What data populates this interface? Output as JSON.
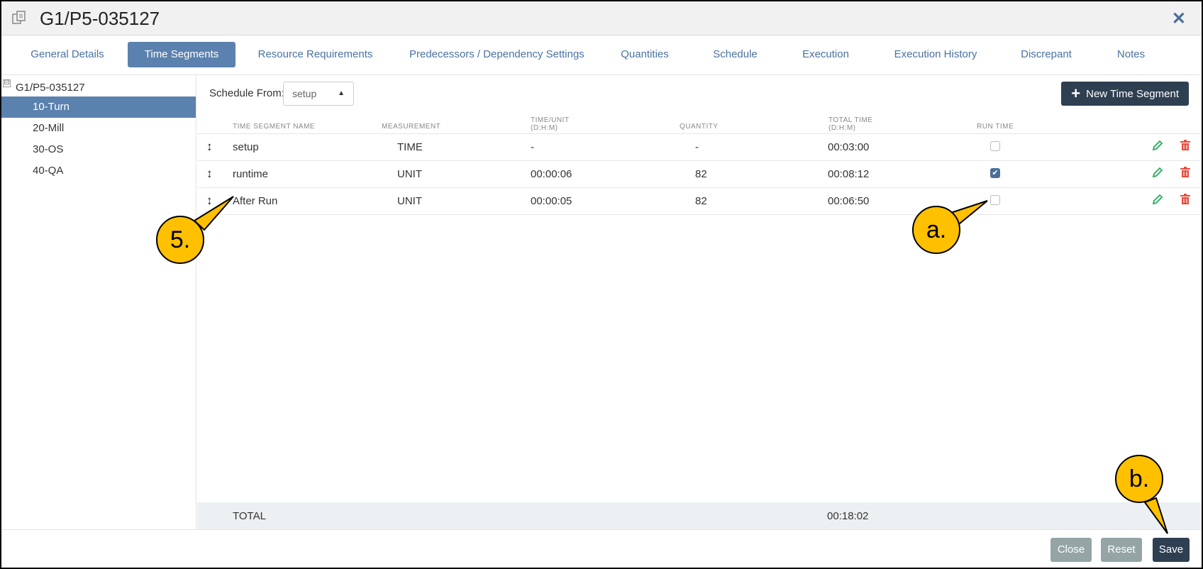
{
  "window": {
    "title": "G1/P5-035127",
    "icon": "copy-icon",
    "close_icon": "close-icon"
  },
  "tabs": [
    {
      "label": "General Details",
      "active": false
    },
    {
      "label": "Time Segments",
      "active": true
    },
    {
      "label": "Resource Requirements",
      "active": false
    },
    {
      "label": "Predecessors / Dependency Settings",
      "active": false
    },
    {
      "label": "Quantities",
      "active": false
    },
    {
      "label": "Schedule",
      "active": false
    },
    {
      "label": "Execution",
      "active": false
    },
    {
      "label": "Execution History",
      "active": false
    },
    {
      "label": "Discrepant",
      "active": false
    },
    {
      "label": "Notes",
      "active": false
    }
  ],
  "tree": {
    "root": "G1/P5-035127",
    "toggle": "⊟",
    "items": [
      {
        "label": "10-Turn",
        "active": true
      },
      {
        "label": "20-Mill",
        "active": false
      },
      {
        "label": "30-OS",
        "active": false
      },
      {
        "label": "40-QA",
        "active": false
      }
    ]
  },
  "schedule_from": {
    "label": "Schedule From:",
    "value": "setup"
  },
  "new_segment_button": "New Time Segment",
  "columns": {
    "name": "TIME SEGMENT NAME",
    "measurement": "MEASUREMENT",
    "time_unit_1": "TIME/UNIT",
    "time_unit_2": "(D:H:M)",
    "quantity": "QUANTITY",
    "total_time_1": "TOTAL TIME",
    "total_time_2": "(D:H:M)",
    "run_time": "RUN TIME"
  },
  "rows": [
    {
      "name": "setup",
      "measurement": "TIME",
      "time_unit": "-",
      "quantity": "-",
      "total_time": "00:03:00",
      "run_time": false
    },
    {
      "name": "runtime",
      "measurement": "UNIT",
      "time_unit": "00:00:06",
      "quantity": "82",
      "total_time": "00:08:12",
      "run_time": true
    },
    {
      "name": "After Run",
      "measurement": "UNIT",
      "time_unit": "00:00:05",
      "quantity": "82",
      "total_time": "00:06:50",
      "run_time": false
    }
  ],
  "total": {
    "label": "TOTAL",
    "value": "00:18:02"
  },
  "footer": {
    "close": "Close",
    "reset": "Reset",
    "save": "Save"
  },
  "callouts": {
    "step5": "5.",
    "a": "a.",
    "b": "b."
  },
  "colors": {
    "accent": "#5b81ae",
    "dark_button": "#2f3f52",
    "grey_button": "#95a5a6",
    "callout": "#ffc000",
    "edit": "#27ae60",
    "delete": "#e74c3c"
  }
}
